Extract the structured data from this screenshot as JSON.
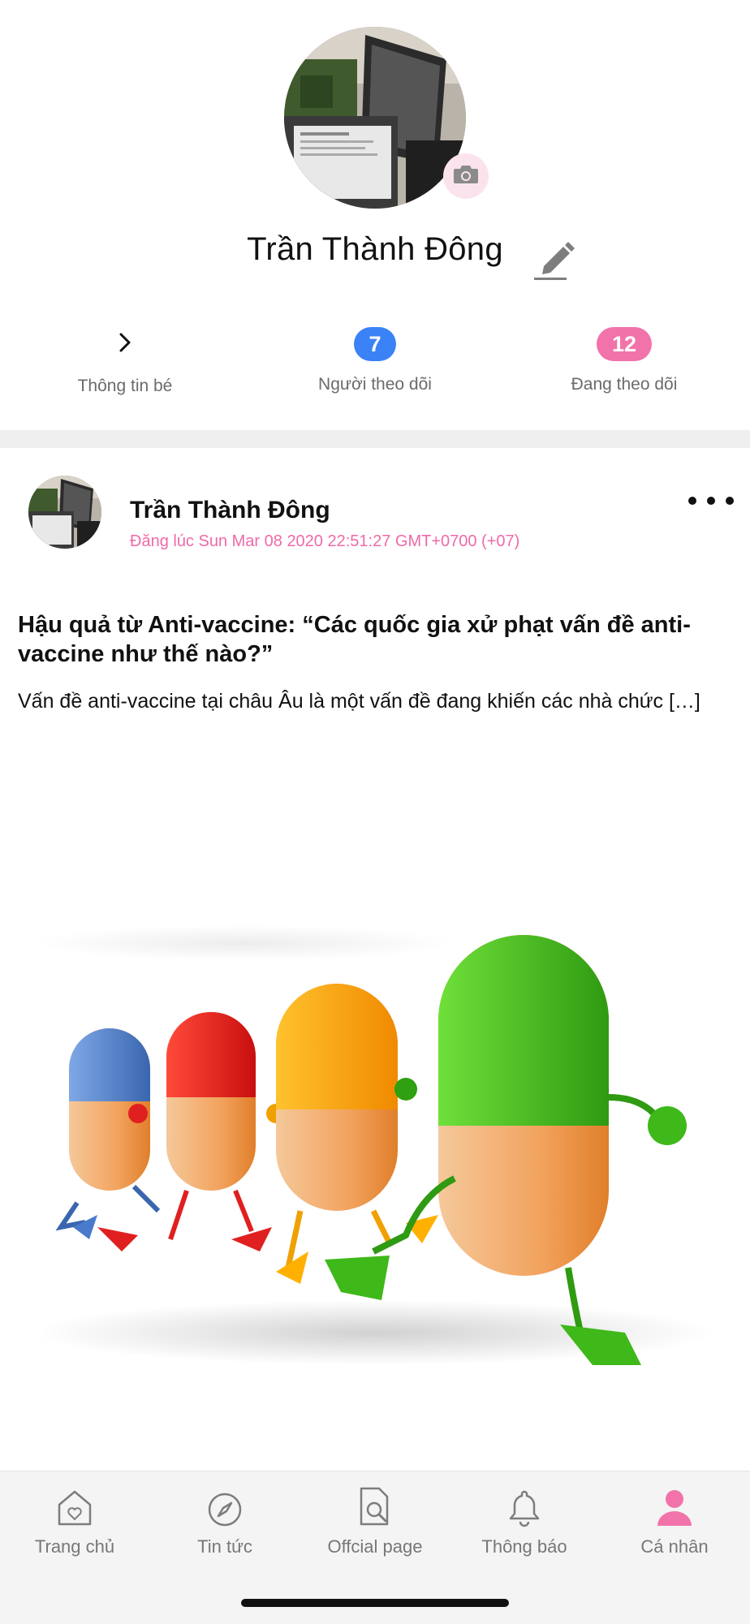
{
  "profile": {
    "name": "Trần Thành Đông",
    "stats": [
      {
        "label": "Thông tin bé",
        "value": ""
      },
      {
        "label": "Người theo dõi",
        "value": "7"
      },
      {
        "label": "Đang theo dõi",
        "value": "12"
      }
    ]
  },
  "post": {
    "author": "Trần Thành Đông",
    "timestamp": "Đăng lúc Sun Mar 08 2020 22:51:27 GMT+0700 (+07)",
    "title": "Hậu quả từ Anti-vaccine: “Các quốc gia xử phạt vấn đề anti-vaccine như thế nào?”",
    "excerpt": "Vấn đề anti-vaccine tại châu Âu là một vấn đề đang khiến các nhà chức […]"
  },
  "tabbar": {
    "items": [
      {
        "label": "Trang chủ",
        "icon": "home-icon"
      },
      {
        "label": "Tin tức",
        "icon": "compass-icon"
      },
      {
        "label": "Offcial page",
        "icon": "document-search-icon"
      },
      {
        "label": "Thông báo",
        "icon": "bell-icon"
      },
      {
        "label": "Cá nhân",
        "icon": "person-icon",
        "active": true
      }
    ]
  },
  "colors": {
    "accent_pink": "#f173aa",
    "accent_blue": "#3b82f6",
    "timestamp_pink": "#ef6aa8"
  }
}
